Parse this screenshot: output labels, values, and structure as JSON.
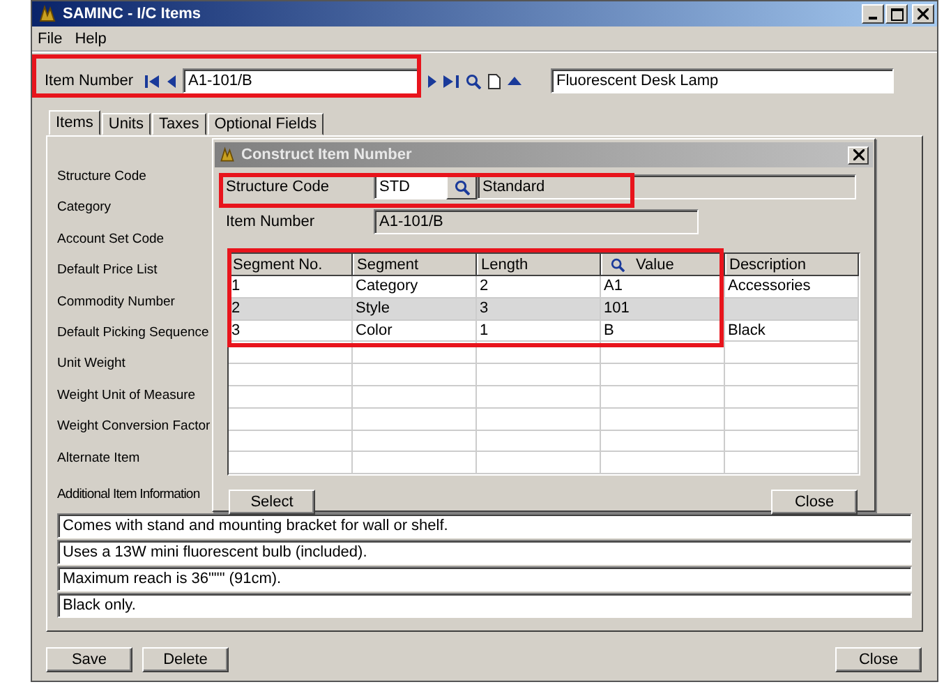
{
  "window": {
    "title": "SAMINC - I/C Items"
  },
  "menu": [
    "File",
    "Help"
  ],
  "item_number": {
    "label": "Item Number",
    "value": "A1-101/B",
    "description": "Fluorescent Desk Lamp"
  },
  "tabs": [
    {
      "label": "Items",
      "selected": true
    },
    {
      "label": "Units",
      "selected": false
    },
    {
      "label": "Taxes",
      "selected": false
    },
    {
      "label": "Optional Fields",
      "selected": false
    }
  ],
  "form_labels": [
    "Structure Code",
    "Category",
    "Account Set Code",
    "Default Price List",
    "Commodity Number",
    "Default Picking Sequence",
    "Unit Weight",
    "Weight Unit of Measure",
    "Weight Conversion Factor",
    "Alternate Item",
    "Additional Item Information"
  ],
  "additional_info": [
    "Comes with stand and mounting bracket for wall or shelf.",
    "Uses a 13W mini fluorescent bulb (included).",
    "Maximum reach is 36\"\"\" (91cm).",
    "Black only."
  ],
  "buttons": [
    "Save",
    "Delete",
    "Close"
  ],
  "dialog": {
    "title": "Construct Item Number",
    "structure_code": {
      "label": "Structure Code",
      "value": "STD",
      "description": "Standard"
    },
    "item_number": {
      "label": "Item Number",
      "value": "A1-101/B"
    },
    "columns": [
      "Segment No.",
      "Segment",
      "Length",
      "Value",
      "Description"
    ],
    "rows": [
      {
        "cells": [
          "1",
          "Category",
          "2",
          "A1",
          "Accessories"
        ],
        "selected": false
      },
      {
        "cells": [
          "2",
          "Style",
          "3",
          "101",
          ""
        ],
        "selected": true
      },
      {
        "cells": [
          "3",
          "Color",
          "1",
          "B",
          "Black"
        ],
        "selected": false
      }
    ],
    "buttons": [
      "Select",
      "Close"
    ]
  }
}
